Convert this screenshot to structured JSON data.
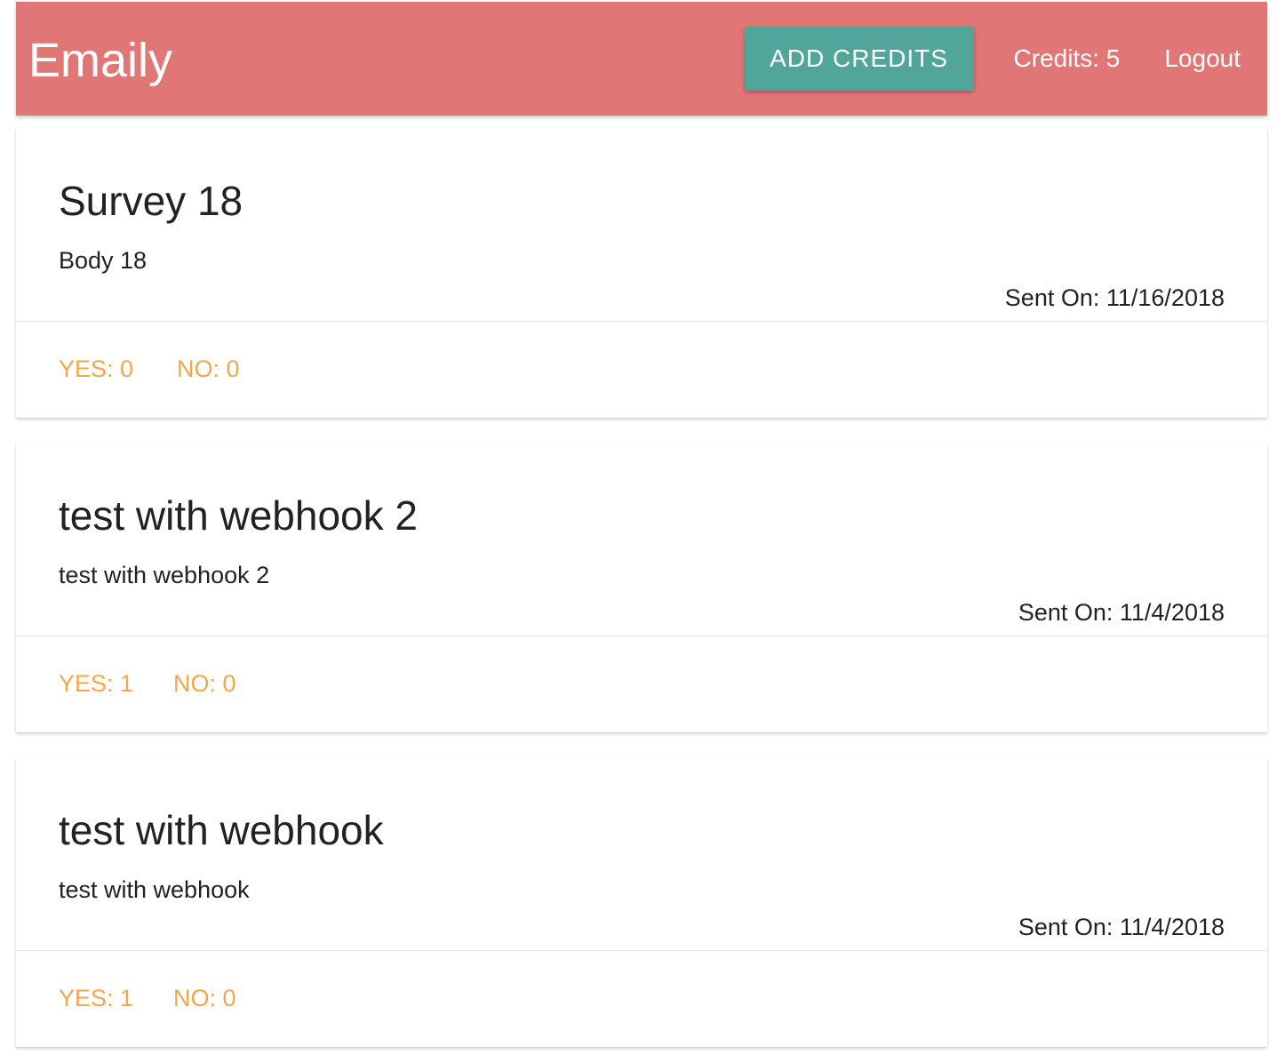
{
  "header": {
    "brand": "Emaily",
    "add_credits_label": "ADD CREDITS",
    "credits_text": "Credits: 5",
    "logout_label": "Logout"
  },
  "colors": {
    "header_bg": "#e07676",
    "button_bg": "#52a59b",
    "vote_text": "#f2a64d",
    "text": "#222222"
  },
  "surveys": [
    {
      "title": "Survey 18",
      "body": "Body 18",
      "sent_on": "Sent On: 11/16/2018",
      "yes": "YES: 0",
      "no": "NO: 0"
    },
    {
      "title": "test with webhook 2",
      "body": "test with webhook 2",
      "sent_on": "Sent On: 11/4/2018",
      "yes": "YES: 1",
      "no": "NO: 0"
    },
    {
      "title": "test with webhook",
      "body": "test with webhook",
      "sent_on": "Sent On: 11/4/2018",
      "yes": "YES: 1",
      "no": "NO: 0"
    }
  ]
}
